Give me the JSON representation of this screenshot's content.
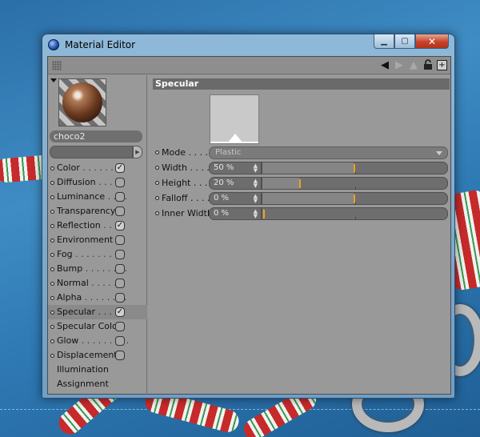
{
  "window": {
    "title": "Material Editor",
    "min_icon": "▁",
    "max_icon": "▢",
    "close_icon": "✕"
  },
  "toolbar": {
    "icons": [
      "grip-icon",
      "back-arrow-icon",
      "forward-arrow-icon",
      "up-arrow-icon",
      "lock-icon",
      "new-window-icon"
    ]
  },
  "material": {
    "name": "choco2"
  },
  "channels": [
    {
      "label": "Color",
      "dots": " . . . . . . . .",
      "checked": true,
      "has_checkbox": true
    },
    {
      "label": "Diffusion",
      "dots": " . . . . .",
      "checked": false,
      "has_checkbox": true
    },
    {
      "label": "Luminance",
      "dots": " . . . .",
      "checked": false,
      "has_checkbox": true
    },
    {
      "label": "Transparency",
      "dots": "",
      "checked": false,
      "has_checkbox": true
    },
    {
      "label": "Reflection",
      "dots": " . . .",
      "checked": true,
      "has_checkbox": true
    },
    {
      "label": "Environment",
      "dots": "",
      "checked": false,
      "has_checkbox": true
    },
    {
      "label": "Fog",
      "dots": " . . . . . . . . .",
      "checked": false,
      "has_checkbox": true
    },
    {
      "label": "Bump",
      "dots": " . . . . . . . .",
      "checked": false,
      "has_checkbox": true
    },
    {
      "label": "Normal",
      "dots": " . . . . . .",
      "checked": false,
      "has_checkbox": true
    },
    {
      "label": "Alpha",
      "dots": " . . . . . . . .",
      "checked": false,
      "has_checkbox": true
    },
    {
      "label": "Specular",
      "dots": " . . . . .",
      "checked": true,
      "has_checkbox": true,
      "active": true
    },
    {
      "label": "Specular Color",
      "dots": "",
      "checked": false,
      "has_checkbox": true
    },
    {
      "label": "Glow",
      "dots": " . . . . . . . . .",
      "checked": false,
      "has_checkbox": true
    },
    {
      "label": "Displacement",
      "dots": "",
      "checked": false,
      "has_checkbox": true
    },
    {
      "label": "Illumination",
      "dots": "",
      "has_checkbox": false
    },
    {
      "label": "Assignment",
      "dots": "",
      "has_checkbox": false
    }
  ],
  "specular": {
    "heading": "Specular",
    "mode": {
      "label": "Mode . . . .",
      "value": "Plastic"
    },
    "width": {
      "label": "Width . . . .",
      "value": "50 %",
      "level": 0.5
    },
    "height": {
      "label": "Height . . .",
      "value": "20 %",
      "level": 0.2
    },
    "falloff": {
      "label": "Falloff . . . .",
      "value": "0 %",
      "level": 0.5
    },
    "inner_width": {
      "label": "Inner Width",
      "value": "0 %",
      "level": 0.0
    }
  },
  "colors": {
    "accent": "#f0a020",
    "panel": "#999999",
    "header": "#6a6a6a"
  }
}
